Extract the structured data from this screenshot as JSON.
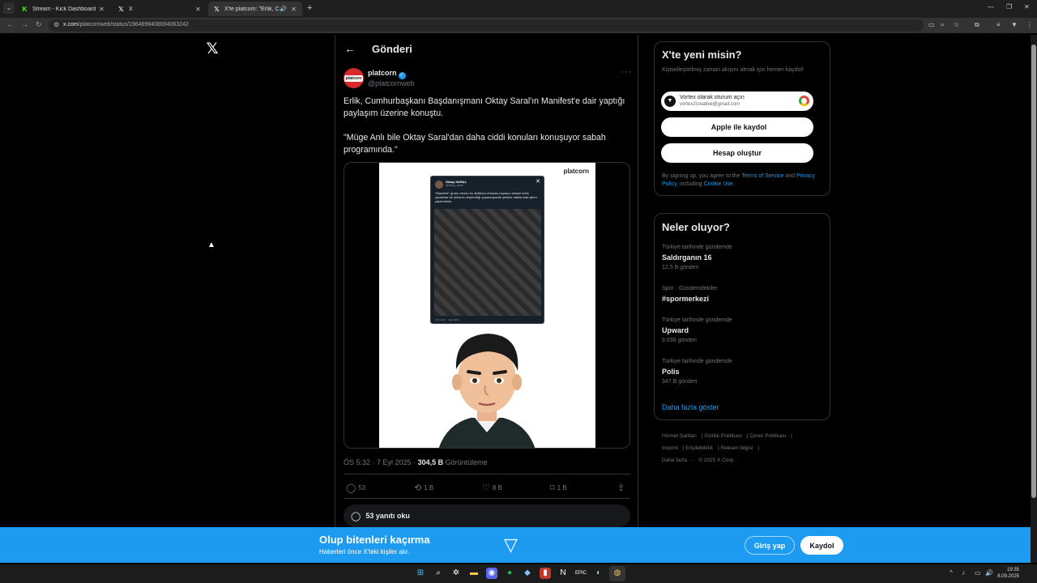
{
  "browser": {
    "tabs": [
      {
        "title": "Stream - Kick Dashboard",
        "favicon": "kick-icon"
      },
      {
        "title": "X",
        "favicon": "x-icon"
      },
      {
        "title": "X'te platcorn: \"Erlik, Cumhu",
        "favicon": "x-icon"
      }
    ],
    "url_host": "x.com",
    "url_path": "/platcornweb/status/1964698408004063242"
  },
  "post": {
    "header_title": "Gönderi",
    "author_name": "platcorn",
    "author_handle": "@platcornweb",
    "avatar_text": "platcorn",
    "text_p1": "Erlik, Cumhurbaşkanı Başdanışmanı Oktay Saral'ın Manifest'e dair yaptığı paylaşım üzerine konuştu.",
    "text_p2": "\"Müge Anlı bile Oktay Saral'dan daha ciddi konuları konuşuyor sabah programında.\"",
    "media": {
      "brand": "platcorn",
      "inner_name": "Oktay SARAL",
      "inner_handle": "@oktay_saral",
      "inner_text": "\"Manifest\" grubu denen bu ahlâksız-edepsiz-hayasız zebani kılıklı yaratıklar bir daha bu teşhirciliği yapamayacak şekilde haklarında işlem yapılmalıdır",
      "inner_date": "ÖS 12:03 · 7 Eyl 2025"
    },
    "time": "ÖS 5:32",
    "date": "7 Eyl 2025",
    "views_value": "304,5 B",
    "views_label": "Görüntüleme",
    "actions": {
      "replies": "53",
      "reposts": "1 B",
      "likes": "8 B",
      "bookmarks": "1 B"
    },
    "read_replies": "53 yanıtı oku"
  },
  "signup_card": {
    "title": "X'te yeni misin?",
    "desc": "Kişiselleştirilmiş zaman akışını almak için hemen kaydol!",
    "google_line1": "Vortex olarak oturum açın",
    "google_line2": "vortex2creative@gmail.com",
    "apple_label": "Apple ile kaydol",
    "create_label": "Hesap oluştur",
    "legal_pre": "By signing up, you agree to the ",
    "tos": "Terms of Service",
    "and": " and ",
    "privacy": "Privacy Policy",
    "including": ", including ",
    "cookie": "Cookie Use",
    "dot": "."
  },
  "trends_card": {
    "title": "Neler oluyor?",
    "items": [
      {
        "context": "Türkiye tarihinde gündemde",
        "name": "Saldırganın 16",
        "count": "12,5 B gönderi"
      },
      {
        "context": "Spor · Gündemdekiler",
        "name": "#spormerkezi",
        "count": ""
      },
      {
        "context": "Türkiye tarihinde gündemde",
        "name": "Upward",
        "count": "9.038 gönderi"
      },
      {
        "context": "Türkiye tarihinde gündemde",
        "name": "Polis",
        "count": "347 B gönderi"
      }
    ],
    "show_more": "Daha fazla göster"
  },
  "footer": {
    "links": [
      "Hizmet Şartları",
      "Gizlilik Politikası",
      "Çerez Politikası",
      "Imprint",
      "Erişilebilirlik",
      "Reklam bilgisi",
      "Daha fazla ···"
    ],
    "copyright": "© 2025 X Corp."
  },
  "banner": {
    "title": "Olup bitenleri kaçırma",
    "subtitle": "Haberleri önce X'teki kişiler alır.",
    "login": "Giriş yap",
    "signup": "Kaydol"
  },
  "taskbar": {
    "time": "19:35",
    "date": "8.09.2025"
  },
  "colors": {
    "accent": "#1d9bf0",
    "background": "#000000",
    "border": "#2f3336",
    "muted_text": "#71767b"
  }
}
